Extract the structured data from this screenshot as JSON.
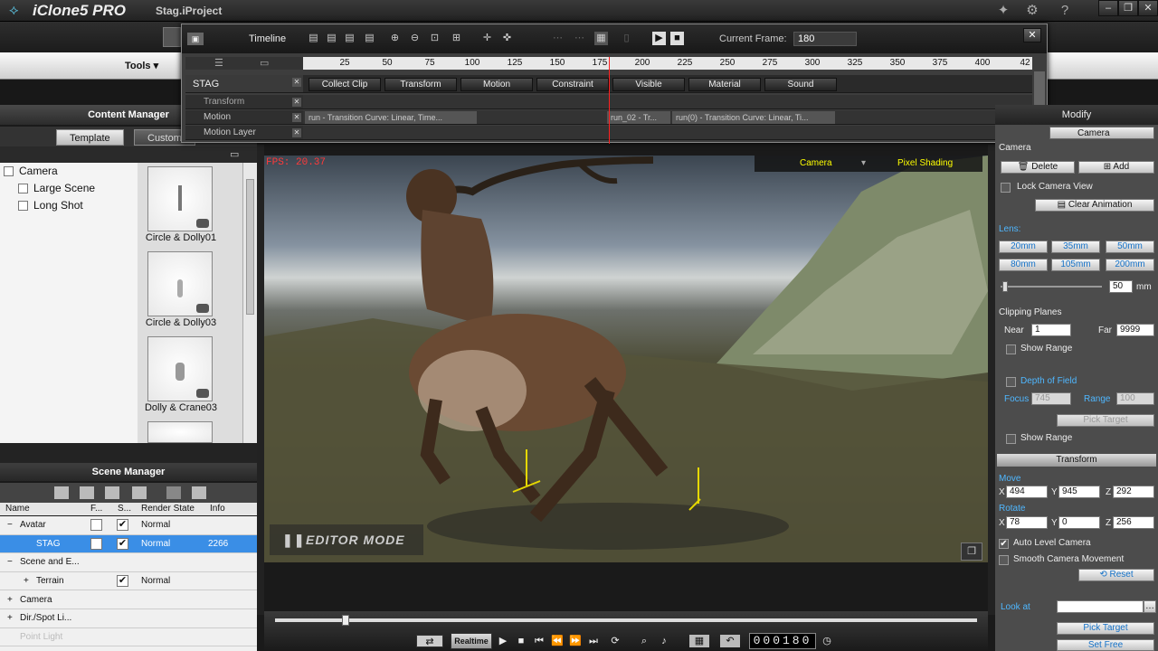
{
  "title": {
    "app": "iClone5 PRO",
    "project": "Stag.iProject"
  },
  "menu": {
    "tools": "Tools ▾"
  },
  "content_manager": {
    "title": "Content Manager",
    "tabs": [
      "Template",
      "Custom"
    ],
    "tree": [
      "Camera",
      "Large Scene",
      "Long Shot"
    ],
    "thumbs": [
      "Circle & Dolly01",
      "Circle & Dolly03",
      "Dolly & Crane03"
    ]
  },
  "scene_manager": {
    "title": "Scene Manager",
    "columns": [
      "Name",
      "F...",
      "S...",
      "Render State",
      "Info"
    ],
    "rows": [
      {
        "name": "Avatar",
        "render": "Normal",
        "info": ""
      },
      {
        "name": "STAG",
        "render": "Normal",
        "info": "2266"
      },
      {
        "name": "Scene and E...",
        "render": "",
        "info": ""
      },
      {
        "name": "Terrain",
        "render": "Normal",
        "info": ""
      },
      {
        "name": "Camera",
        "render": "",
        "info": ""
      },
      {
        "name": "Dir./Spot Li...",
        "render": "",
        "info": ""
      },
      {
        "name": "Point Light",
        "render": "",
        "info": ""
      }
    ]
  },
  "timeline": {
    "title": "Timeline",
    "current_frame_label": "Current Frame:",
    "current_frame": "180",
    "ruler": [
      "25",
      "50",
      "75",
      "100",
      "125",
      "150",
      "175",
      "200",
      "225",
      "250",
      "275",
      "300",
      "325",
      "350",
      "375",
      "400",
      "42"
    ],
    "object": "STAG",
    "tracks": [
      "Transform",
      "Motion",
      "Motion Layer"
    ],
    "chips": [
      "Collect Clip",
      "Transform",
      "Motion",
      "Constraint",
      "Visible",
      "Material",
      "Sound"
    ],
    "clips": [
      "run - Transition Curve: Linear, Time...",
      "run_02 - Tr...",
      "run(0) - Transition Curve: Linear, Ti..."
    ]
  },
  "viewport": {
    "fps": "FPS: 20.37",
    "camera": "Camera",
    "shading": "Pixel Shading",
    "mode": "EDITOR MODE",
    "realtime": "Realtime",
    "frame": "000180"
  },
  "modify": {
    "title": "Modify",
    "selector": "Camera",
    "section": "Camera",
    "delete": "Delete",
    "add": "Add",
    "lock": "Lock Camera View",
    "clear": "Clear Animation",
    "lens": "Lens:",
    "lenses": [
      "20mm",
      "35mm",
      "50mm",
      "80mm",
      "105mm",
      "200mm"
    ],
    "lens_value": "50",
    "mm": "mm",
    "clipping": "Clipping Planes",
    "near_label": "Near",
    "near": "1",
    "far_label": "Far",
    "far": "9999",
    "show_range": "Show Range",
    "dof": "Depth of Field",
    "focus_label": "Focus",
    "focus": "745",
    "range_label": "Range",
    "range": "100",
    "pick_target": "Pick Target",
    "transform": "Transform",
    "move": "Move",
    "move_x": "494",
    "move_y": "945",
    "move_z": "292",
    "rotate": "Rotate",
    "rot_x": "78",
    "rot_y": "0",
    "rot_z": "256",
    "auto_level": "Auto Level Camera",
    "smooth": "Smooth Camera Movement",
    "reset": "Reset",
    "look_at": "Look at",
    "set_free": "Set Free"
  }
}
